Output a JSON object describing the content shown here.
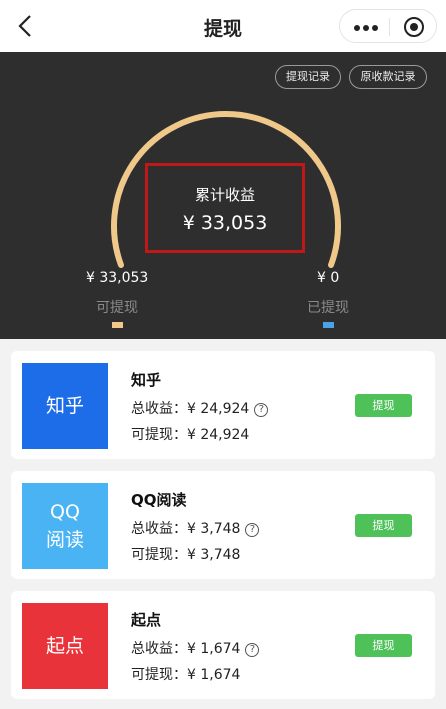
{
  "nav": {
    "title": "提现",
    "back_icon": "chevron-left-icon",
    "more_icon": "more-dots-icon",
    "target_icon": "target-icon"
  },
  "hero": {
    "links": [
      "提现记录",
      "原收款记录"
    ],
    "summary_label": "累计收益",
    "summary_value": "¥ 33,053",
    "withdrawable_value": "¥ 33,053",
    "withdrawable_label": "可提现",
    "withdrawn_value": "¥ 0",
    "withdrawn_label": "已提现",
    "colors": {
      "gauge": "#f0c98a",
      "withdrawable": "#f0c98a",
      "withdrawn": "#4aa3e8",
      "highlight": "#c01818"
    }
  },
  "platforms": [
    {
      "logo_lines": [
        "知乎"
      ],
      "logo_color": "#1e6de8",
      "name": "知乎",
      "total_label": "总收益：",
      "total": "¥ 24,924",
      "avail_label": "可提现：",
      "avail": "¥ 24,924",
      "button": "提现"
    },
    {
      "logo_lines": [
        "QQ",
        "阅读"
      ],
      "logo_color": "#4ab3f4",
      "name": "QQ阅读",
      "total_label": "总收益：",
      "total": "¥ 3,748",
      "avail_label": "可提现：",
      "avail": "¥ 3,748",
      "button": "提现"
    },
    {
      "logo_lines": [
        "起点"
      ],
      "logo_color": "#e8333a",
      "name": "起点",
      "total_label": "总收益：",
      "total": "¥ 1,674",
      "avail_label": "可提现：",
      "avail": "¥ 1,674",
      "button": "提现"
    }
  ],
  "button_color": "#4fc159"
}
